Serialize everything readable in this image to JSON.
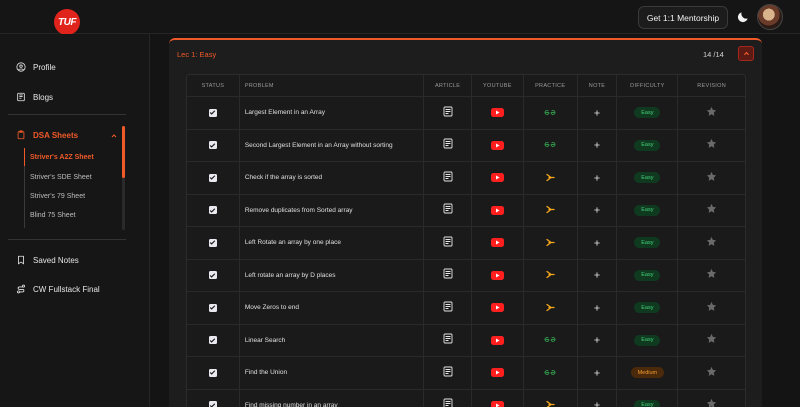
{
  "header": {
    "logo_text": "TUF",
    "mentorship_button": "Get 1:1 Mentorship",
    "theme_icon": "moon-icon",
    "avatar": "user-avatar"
  },
  "sidebar": {
    "profile": "Profile",
    "blogs": "Blogs",
    "dsa_sheets": "DSA Sheets",
    "sheets": [
      {
        "label": "Striver's A2Z Sheet",
        "active": true
      },
      {
        "label": "Striver's SDE Sheet",
        "active": false
      },
      {
        "label": "Striver's 79 Sheet",
        "active": false
      },
      {
        "label": "Blind 75 Sheet",
        "active": false
      }
    ],
    "saved_notes": "Saved Notes",
    "cw_fullstack": "CW Fullstack Final"
  },
  "lecture": {
    "title": "Lec 1: Easy",
    "count": "14 /14"
  },
  "table": {
    "headers": {
      "status": "STATUS",
      "problem": "PROBLEM",
      "article": "ARTICLE",
      "youtube": "YOUTUBE",
      "practice": "PRACTICE",
      "note": "NOTE",
      "difficulty": "DIFFICULTY",
      "revision": "REVISION"
    },
    "rows": [
      {
        "problem": "Largest Element in an Array",
        "practice": "gfg",
        "difficulty": "Easy"
      },
      {
        "problem": "Second Largest Element in an Array without sorting",
        "practice": "gfg",
        "difficulty": "Easy"
      },
      {
        "problem": "Check if the array is sorted",
        "practice": "codestudio",
        "difficulty": "Easy"
      },
      {
        "problem": "Remove duplicates from Sorted array",
        "practice": "codestudio",
        "difficulty": "Easy"
      },
      {
        "problem": "Left Rotate an array by one place",
        "practice": "codestudio",
        "difficulty": "Easy"
      },
      {
        "problem": "Left rotate an array by D places",
        "practice": "codestudio",
        "difficulty": "Easy"
      },
      {
        "problem": "Move Zeros to end",
        "practice": "codestudio",
        "difficulty": "Easy"
      },
      {
        "problem": "Linear Search",
        "practice": "gfg",
        "difficulty": "Easy"
      },
      {
        "problem": "Find the Union",
        "practice": "gfg",
        "difficulty": "Medium"
      },
      {
        "problem": "Find missing number in an array",
        "practice": "codestudio",
        "difficulty": "Easy"
      }
    ]
  },
  "colors": {
    "accent": "#f05a28",
    "easy": "#46d27a",
    "medium": "#f59a2b",
    "youtube": "#ff1f1f",
    "gfg": "#2f8d46",
    "codestudio": "#f6a81c"
  }
}
